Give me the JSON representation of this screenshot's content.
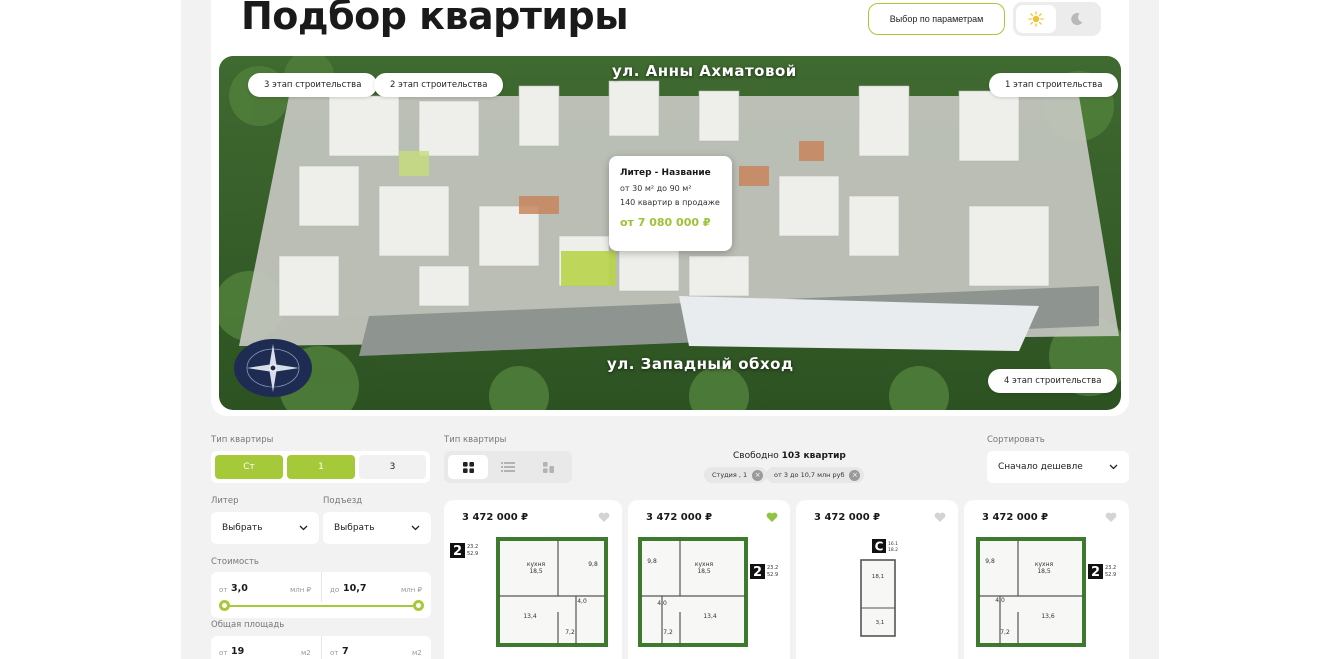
{
  "header": {
    "title": "Подбор квартиры",
    "param_button": "Выбор по параметрам",
    "theme": {
      "light_icon": "sun-icon",
      "dark_icon": "moon-icon",
      "selected": "light"
    }
  },
  "map": {
    "stages": {
      "stage3": "3 этап строительства",
      "stage2": "2 этап строительства",
      "stage1": "1 этап строительства",
      "stage4": "4 этап строительства"
    },
    "streets": {
      "top": "ул. Анны Ахматовой",
      "bottom": "ул. Западный обход"
    },
    "tooltip": {
      "title": "Литер - Название",
      "area": "от 30 м² до 90 м²",
      "count": "140 квартир в продаже",
      "price": "от 7 080 000 ₽"
    },
    "compass_icon": "compass-icon"
  },
  "filters": {
    "apt_type_label": "Тип квартиры",
    "apt_types": [
      "Ст",
      "1",
      "3"
    ],
    "apt_types_selected": [
      "Ст",
      "1"
    ],
    "view_label": "Тип квартиры",
    "view_icons": [
      "grid-icon",
      "list-icon",
      "tiles-icon"
    ],
    "liter_label": "Литер",
    "liter_value": "Выбрать",
    "entrance_label": "Подъезд",
    "entrance_value": "Выбрать",
    "cost_label": "Стоимость",
    "cost": {
      "from_prefix": "от",
      "from": "3,0",
      "to_prefix": "до",
      "to": "10,7",
      "unit": "млн ₽"
    },
    "area_label": "Общая площадь",
    "area": {
      "from_prefix": "от",
      "from": "19",
      "to_prefix": "от",
      "to": "7",
      "unit": "м2"
    }
  },
  "results": {
    "free_prefix": "Свободно",
    "free_count": "103 квартир",
    "chips": [
      "Студия , 1",
      "от 3 до 10,7 млн руб"
    ],
    "sort_label": "Сортировать",
    "sort_value": "Сначало дешевле"
  },
  "cards": [
    {
      "price": "3 472 000 ₽",
      "favorite": false,
      "rooms": "2",
      "area_a": "23.2",
      "area_b": "52.9",
      "kitchen": "кухня",
      "r1": "18,5",
      "r2": "9,8",
      "r3": "4,0",
      "r4": "13,4",
      "r5": "7,2"
    },
    {
      "price": "3 472 000 ₽",
      "favorite": true,
      "rooms": "2",
      "area_a": "23.2",
      "area_b": "52.9",
      "kitchen": "кухня",
      "r1": "18,5",
      "r2": "9,8",
      "r3": "4,0",
      "r4": "13,4",
      "r5": "7,2"
    },
    {
      "price": "3 472 000 ₽",
      "favorite": false,
      "rooms": "С",
      "area_a": "16.1",
      "area_b": "18.2",
      "r1": "18,1",
      "r2": "3,1"
    },
    {
      "price": "3 472 000 ₽",
      "favorite": false,
      "rooms": "2",
      "area_a": "23.2",
      "area_b": "52.9",
      "kitchen": "кухня",
      "r1": "18,5",
      "r2": "9,8",
      "r3": "4,0",
      "r4": "13,6",
      "r5": "7,2"
    }
  ],
  "colors": {
    "accent": "#a6c93a",
    "heart_active": "#8cc63f",
    "plan_wall": "#3d7a2e"
  }
}
